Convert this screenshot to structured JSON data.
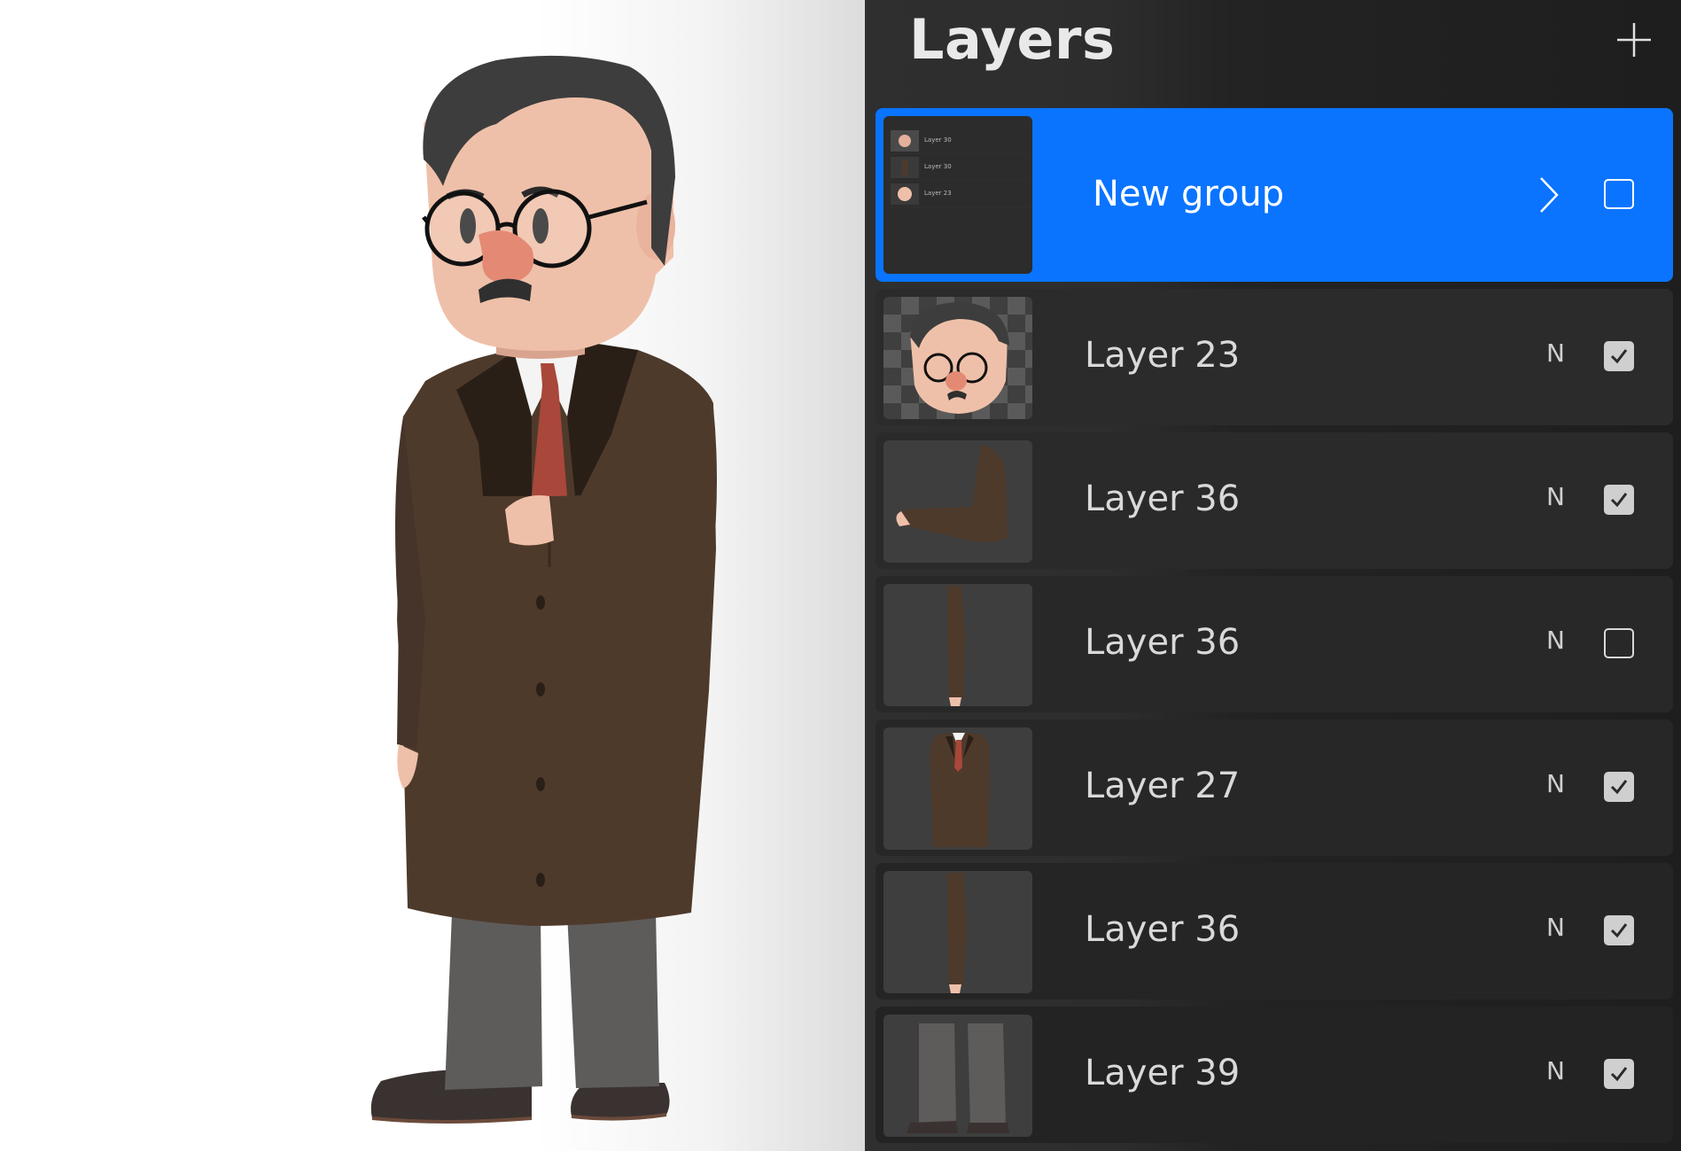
{
  "panel": {
    "title": "Layers",
    "add_icon": "plus-icon",
    "layers": [
      {
        "name": "New group",
        "mode": "",
        "visible": false,
        "selected": true,
        "is_group": true,
        "group_preview_labels": [
          "Layer 30",
          "Layer 30",
          "Layer 23"
        ]
      },
      {
        "name": "Layer 23",
        "mode": "N",
        "visible": true,
        "selected": false
      },
      {
        "name": "Layer 36",
        "mode": "N",
        "visible": true,
        "selected": false
      },
      {
        "name": "Layer 36",
        "mode": "N",
        "visible": false,
        "selected": false
      },
      {
        "name": "Layer 27",
        "mode": "N",
        "visible": true,
        "selected": false
      },
      {
        "name": "Layer 36",
        "mode": "N",
        "visible": true,
        "selected": false
      },
      {
        "name": "Layer 39",
        "mode": "N",
        "visible": true,
        "selected": false
      }
    ]
  },
  "colors": {
    "selection": "#0a74ff",
    "panel_bg": "#1e1e1e",
    "coat": "#4e3a2b",
    "skin": "#efc0a9",
    "tie": "#a8473a",
    "pants": "#5d5b5a"
  }
}
